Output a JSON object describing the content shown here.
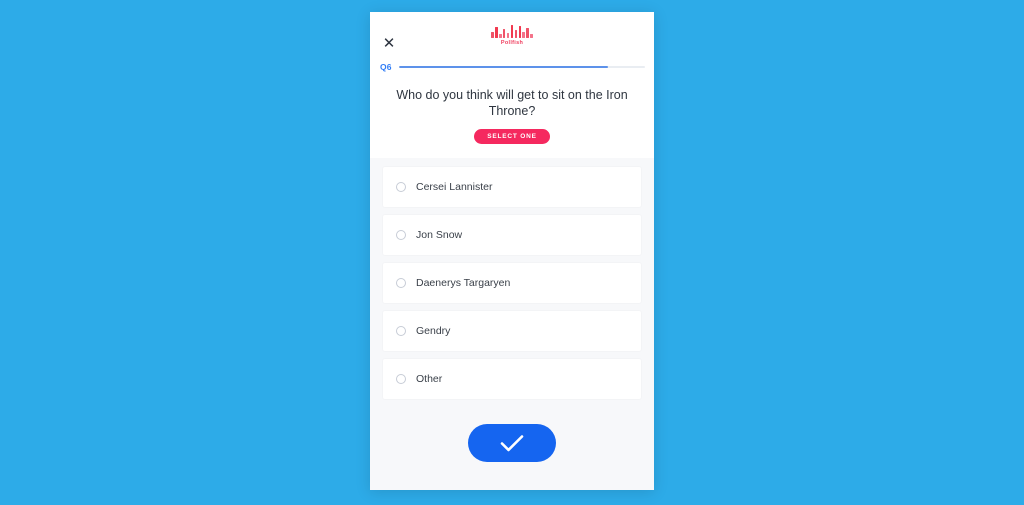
{
  "background": {
    "color": "#2dabe8"
  },
  "card": {
    "background": "#f7f8fa"
  },
  "header": {
    "close_label": "✕",
    "close_icon": "close-icon",
    "brand_name": "Pollfish",
    "brand_icon": "waveform-icon",
    "brand_color": "#ef4060"
  },
  "progress": {
    "question_label": "Q6",
    "percent": 85,
    "fill_color": "#5d92ea",
    "track_color": "#e9edf2",
    "label_color": "#2f7cf6"
  },
  "question": {
    "text": "Who do you think will get to sit on the Iron Throne?",
    "badge": "SELECT ONE",
    "badge_color": "#f5295f"
  },
  "options": [
    {
      "label": "Cersei Lannister",
      "selected": false,
      "icon": "radio-unchecked-icon"
    },
    {
      "label": "Jon Snow",
      "selected": false,
      "icon": "radio-unchecked-icon"
    },
    {
      "label": "Daenerys Targaryen",
      "selected": false,
      "icon": "radio-unchecked-icon"
    },
    {
      "label": "Gendry",
      "selected": false,
      "icon": "radio-unchecked-icon"
    },
    {
      "label": "Other",
      "selected": false,
      "icon": "radio-unchecked-icon"
    }
  ],
  "submit": {
    "icon": "checkmark-icon",
    "color": "#1565f0",
    "aria_label": "Submit answer"
  }
}
